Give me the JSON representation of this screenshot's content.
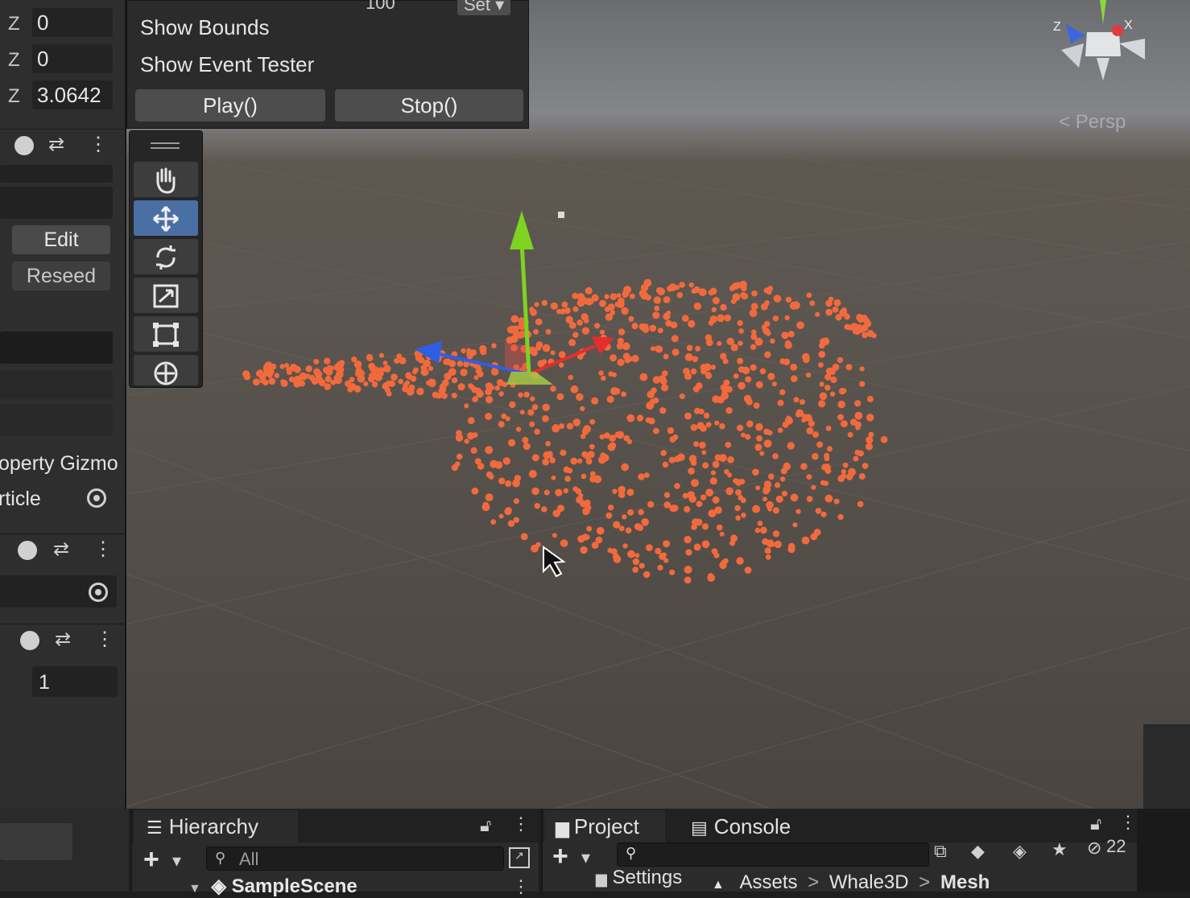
{
  "inspector": {
    "transform_rows": [
      {
        "axis": "Z",
        "value": "0"
      },
      {
        "axis": "Z",
        "value": "0"
      },
      {
        "axis": "Z",
        "value": "3.0642"
      }
    ],
    "edit_label": "Edit",
    "reseed_label": "Reseed",
    "property_gizmo_label": "operty Gizmo",
    "particle_label": "rticle",
    "int_field_value": "1"
  },
  "vfx_panel": {
    "cut_value": "100",
    "cut_set": "Set",
    "show_bounds": "Show Bounds",
    "show_event_tester": "Show Event Tester",
    "play_label": "Play()",
    "stop_label": "Stop()"
  },
  "scene": {
    "persp_label": "Persp",
    "gizmo_axes": {
      "x": "X",
      "z": "Z"
    },
    "particle_color": "#f26a3c"
  },
  "hierarchy": {
    "tab_label": "Hierarchy",
    "search_placeholder": "All",
    "scene_name": "SampleScene"
  },
  "project": {
    "project_tab": "Project",
    "console_tab": "Console",
    "settings_label": "Settings",
    "breadcrumb": [
      "Assets",
      "Whale3D",
      "Mesh"
    ],
    "hidden_count": "22"
  },
  "colors": {
    "x_axis": "#e52d2d",
    "y_axis": "#7ed321",
    "z_axis": "#2f5ee6",
    "active_tool": "#4a6fa5"
  }
}
